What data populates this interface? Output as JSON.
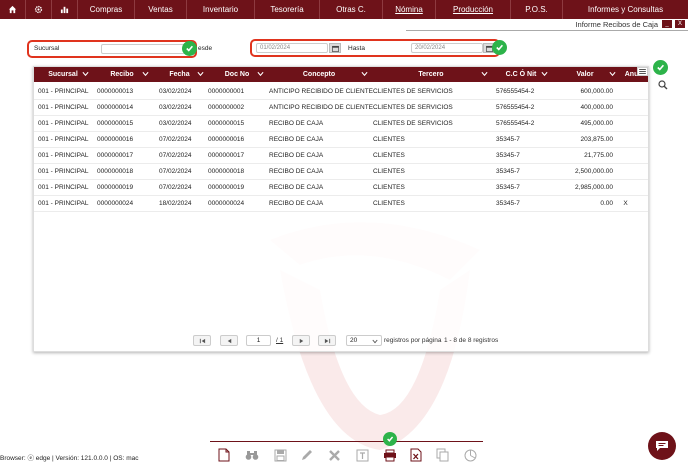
{
  "nav": {
    "icons": [
      "home-icon",
      "gear-icon",
      "bar-chart-icon"
    ],
    "menus": [
      "Compras",
      "Ventas",
      "Inventario",
      "Tesorería",
      "Otras C.",
      "Nómina",
      "Producción",
      "P.O.S.",
      "Informes y Consultas"
    ]
  },
  "panel": {
    "title": "Informe Recibos de Caja",
    "minimize": "_",
    "close": "X"
  },
  "filters": {
    "sucursal_label": "Sucursal",
    "sucursal_value": "",
    "desde_label": "esde",
    "desde_value": "01/02/2024",
    "hasta_label": "Hasta",
    "hasta_value": "20/02/2024"
  },
  "table": {
    "columns": [
      "Sucursal",
      "Recibo",
      "Fecha",
      "Doc No",
      "Concepto",
      "Tercero",
      "C.C Ó Nit",
      "Valor",
      "Anul."
    ],
    "rows": [
      [
        "001 - PRINCIPAL",
        "0000000013",
        "03/02/2024",
        "0000000001",
        "ANTICIPO RECIBIDO DE CLIENTE",
        "CLIENTES DE SERVICIOS",
        "576555454-2",
        "600,000.00",
        ""
      ],
      [
        "001 - PRINCIPAL",
        "0000000014",
        "03/02/2024",
        "0000000002",
        "ANTICIPO RECIBIDO DE CLIENTE",
        "CLIENTES DE SERVICIOS",
        "576555454-2",
        "400,000.00",
        ""
      ],
      [
        "001 - PRINCIPAL",
        "0000000015",
        "03/02/2024",
        "0000000015",
        "RECIBO DE CAJA",
        "CLIENTES DE SERVICIOS",
        "576555454-2",
        "495,000.00",
        ""
      ],
      [
        "001 - PRINCIPAL",
        "0000000016",
        "07/02/2024",
        "0000000016",
        "RECIBO DE CAJA",
        "CLIENTES",
        "35345-7",
        "203,875.00",
        ""
      ],
      [
        "001 - PRINCIPAL",
        "0000000017",
        "07/02/2024",
        "0000000017",
        "RECIBO DE CAJA",
        "CLIENTES",
        "35345-7",
        "21,775.00",
        ""
      ],
      [
        "001 - PRINCIPAL",
        "0000000018",
        "07/02/2024",
        "0000000018",
        "RECIBO DE CAJA",
        "CLIENTES",
        "35345-7",
        "2,500,000.00",
        ""
      ],
      [
        "001 - PRINCIPAL",
        "0000000019",
        "07/02/2024",
        "0000000019",
        "RECIBO DE CAJA",
        "CLIENTES",
        "35345-7",
        "2,985,000.00",
        ""
      ],
      [
        "001 - PRINCIPAL",
        "0000000024",
        "18/02/2024",
        "0000000024",
        "RECIBO DE CAJA",
        "CLIENTES",
        "35345-7",
        "0.00",
        "X"
      ]
    ]
  },
  "pager": {
    "page_value": "1",
    "page_total": "/ 1",
    "per_page_value": "20",
    "per_page_label": "registros por página",
    "range_text": "1 - 8 de 8 registros"
  },
  "footer": {
    "browser_info": "Browser: ⓔ edge | Versión: 121.0.0.0 | OS: mac"
  },
  "colors": {
    "brand": "#6e1219",
    "highlight": "#e0341e",
    "check": "#2db34a"
  }
}
